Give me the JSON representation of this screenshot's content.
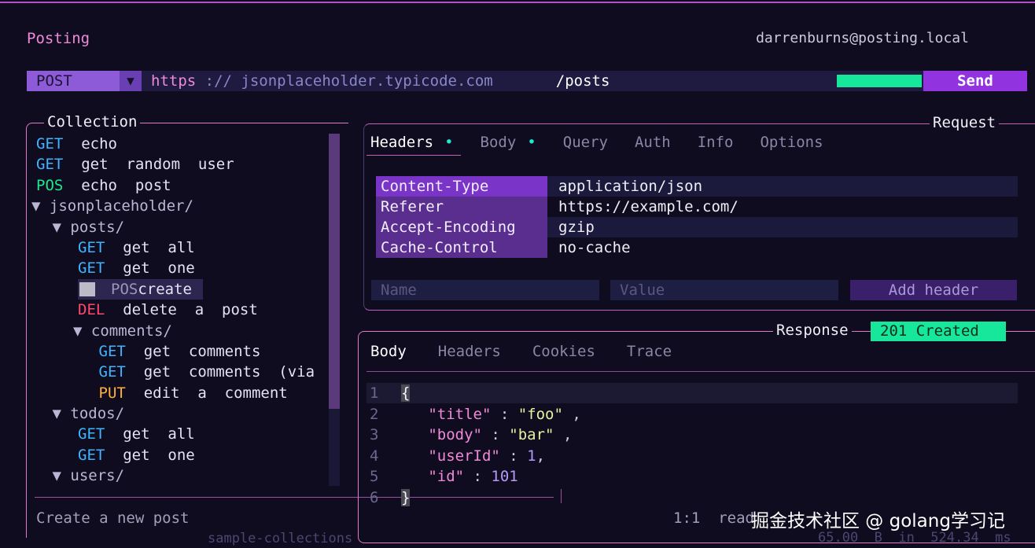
{
  "app": {
    "title": "Posting",
    "user": "darrenburns@posting.local"
  },
  "urlbar": {
    "method": "POST",
    "scheme": "https",
    "sep": " :// ",
    "host": "jsonplaceholder.typicode.com",
    "path": "/posts",
    "send_label": "Send"
  },
  "collection": {
    "title": "Collection",
    "items": [
      {
        "method": "GET",
        "label": "echo",
        "kind": "get",
        "indent": 0
      },
      {
        "method": "GET",
        "label": "get  random  user",
        "kind": "get",
        "indent": 0
      },
      {
        "method": "POS",
        "label": "echo  post",
        "kind": "pos",
        "indent": 0
      },
      {
        "folder": "▼ jsonplaceholder/",
        "indent": 0
      },
      {
        "folder": "▼ posts/",
        "indent": 1
      },
      {
        "method": "GET",
        "label": "get  all",
        "kind": "get",
        "indent": 2
      },
      {
        "method": "GET",
        "label": "get  one",
        "kind": "get",
        "indent": 2
      },
      {
        "method": "POS",
        "label": "create",
        "kind": "pos",
        "indent": 2,
        "selected": true
      },
      {
        "method": "DEL",
        "label": "delete  a  post",
        "kind": "del",
        "indent": 2
      },
      {
        "folder": "▼ comments/",
        "indent": 2
      },
      {
        "method": "GET",
        "label": "get  comments",
        "kind": "get",
        "indent": 3
      },
      {
        "method": "GET",
        "label": "get  comments  (via",
        "kind": "get",
        "indent": 3
      },
      {
        "method": "PUT",
        "label": "edit  a  comment",
        "kind": "put",
        "indent": 3
      },
      {
        "folder": "▼ todos/",
        "indent": 1
      },
      {
        "method": "GET",
        "label": "get  all",
        "kind": "get",
        "indent": 2
      },
      {
        "method": "GET",
        "label": "get  one",
        "kind": "get",
        "indent": 2
      },
      {
        "folder": "▼ users/",
        "indent": 1
      }
    ],
    "create_new": "Create  a  new  post",
    "footer": "sample-collections"
  },
  "request": {
    "title": "Request",
    "tabs": [
      {
        "label": "Headers",
        "dot": "•"
      },
      {
        "label": "Body",
        "dot": "•"
      },
      {
        "label": "Query",
        "dot": ""
      },
      {
        "label": "Auth",
        "dot": ""
      },
      {
        "label": "Info",
        "dot": ""
      },
      {
        "label": "Options",
        "dot": ""
      }
    ],
    "headers": [
      {
        "key": "Content-Type",
        "value": "application/json"
      },
      {
        "key": "Referer",
        "value": "https://example.com/"
      },
      {
        "key": "Accept-Encoding",
        "value": "gzip"
      },
      {
        "key": "Cache-Control",
        "value": "no-cache"
      }
    ],
    "name_placeholder": "Name",
    "value_placeholder": "Value",
    "add_header_label": "Add  header"
  },
  "response": {
    "title": "Response",
    "status": "201  Created",
    "tabs": [
      "Body",
      "Headers",
      "Cookies",
      "Trace"
    ],
    "cursor": "1:1",
    "mode": "read",
    "size_line": "65.00  B  in  524.34  ms",
    "watermark": "掘金技术社区 @ golang学习记",
    "code": [
      {
        "ln": "1"
      },
      {
        "ln": "2",
        "key": "\"title\"",
        "val": "\"foo\"",
        "type": "s",
        "tail": " ,"
      },
      {
        "ln": "3",
        "key": "\"body\"",
        "val": "\"bar\"",
        "type": "s",
        "tail": " ,"
      },
      {
        "ln": "4",
        "key": "\"userId\"",
        "val": "1",
        "type": "n",
        "tail": ","
      },
      {
        "ln": "5",
        "key": "\"id\"",
        "val": "101",
        "type": "n",
        "tail": ""
      },
      {
        "ln": "6"
      }
    ],
    "open_brace": "{",
    "close_brace": "}"
  }
}
